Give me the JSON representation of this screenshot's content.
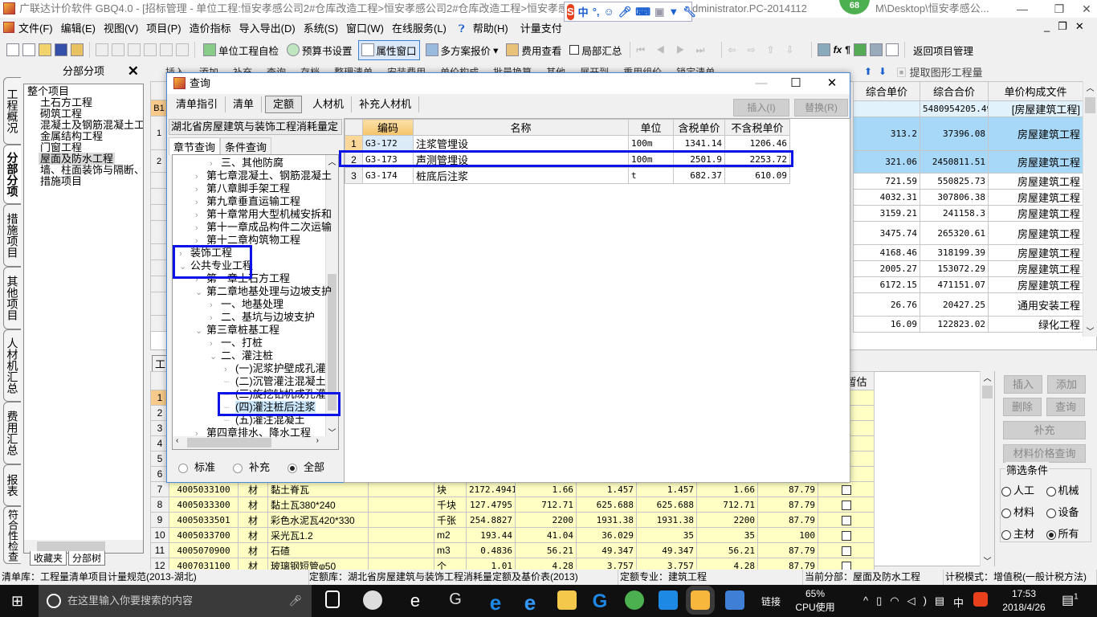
{
  "window": {
    "title": "广联达计价软件 GBQ4.0 - [招标管理 - 单位工程:恒安孝感公司2#仓库改造工程>恒安孝感公司2#仓库改造工程>恒安孝感公司2#",
    "title_tail": "dministrator.PC-2014112",
    "title_tail2": "M\\Desktop\\恒安孝感公...",
    "badge": "68",
    "ime": {
      "logo": "S",
      "mode": "中",
      "punct": "°,"
    }
  },
  "menu": [
    "文件(F)",
    "编辑(E)",
    "视图(V)",
    "项目(P)",
    "造价指标",
    "导入导出(D)",
    "系统(S)",
    "窗口(W)",
    "在线服务(L)",
    "帮助(H)",
    "计量支付"
  ],
  "toolbar": {
    "self_check": "单位工程自检",
    "budget_settings": "预算书设置",
    "property_window": "属性窗口",
    "multi_quote": "多方案报价",
    "fee_view": "费用查看",
    "partial_sum": "局部汇总",
    "return_project": "返回项目管理"
  },
  "toolbar2": {
    "items": [
      "插入",
      "添加",
      "补充",
      "查询",
      "存档",
      "整理清单",
      "安装费用",
      "单价构成",
      "批量换算",
      "其他",
      "展开到",
      "重用组价",
      "锁定清单"
    ],
    "extract": "提取图形工程量"
  },
  "vtabs": [
    "工程概况",
    "分部分项",
    "措施项目",
    "其他项目",
    "人材机汇总",
    "费用汇总",
    "报表",
    "符合性检查"
  ],
  "left_panel": {
    "title": "分部分项",
    "root": "整个项目",
    "items": [
      "土石方工程",
      "砌筑工程",
      "混凝土及钢筋混凝土工程",
      "金属结构工程",
      "门窗工程",
      "屋面及防水工程",
      "墙、柱面装饰与隔断、幕墙工程",
      "措施项目"
    ],
    "selected": "屋面及防水工程",
    "bottom_tabs": [
      "收藏夹",
      "分部树"
    ]
  },
  "main_grid": {
    "columns": [
      "综合单价",
      "综合合价",
      "单价构成文件"
    ],
    "row_headers": [
      "B1",
      "1",
      "2",
      "",
      "",
      "",
      "",
      "",
      "",
      "",
      "",
      ""
    ],
    "rows": [
      [
        "",
        "5480954205.49",
        "[房屋建筑工程]"
      ],
      [
        "313.2",
        "37396.08",
        "房屋建筑工程"
      ],
      [
        "321.06",
        "2450811.51",
        "房屋建筑工程"
      ],
      [
        "721.59",
        "550825.73",
        "房屋建筑工程"
      ],
      [
        "4032.31",
        "307806.38",
        "房屋建筑工程"
      ],
      [
        "3159.21",
        "241158.3",
        "房屋建筑工程"
      ],
      [
        "3475.74",
        "265320.61",
        "房屋建筑工程"
      ],
      [
        "4168.46",
        "318199.39",
        "房屋建筑工程"
      ],
      [
        "2005.27",
        "153072.29",
        "房屋建筑工程"
      ],
      [
        "6172.15",
        "471151.07",
        "房屋建筑工程"
      ],
      [
        "26.76",
        "20427.25",
        "通用安装工程"
      ],
      [
        "16.09",
        "122823.02",
        "绿化工程"
      ]
    ]
  },
  "bottom_grid": {
    "tab": "工",
    "last_column": "是否暂估",
    "rows": [
      [
        "1",
        "",
        "",
        "",
        "",
        "",
        "",
        "",
        "",
        "",
        "",
        "",
        false
      ],
      [
        "2",
        "",
        "",
        "",
        "",
        "",
        "",
        "",
        "",
        "",
        "",
        "",
        false
      ],
      [
        "3",
        "",
        "",
        "",
        "",
        "",
        "",
        "",
        "",
        "",
        "",
        "",
        false
      ],
      [
        "4",
        "",
        "",
        "",
        "",
        "",
        "",
        "",
        "",
        "",
        "",
        "",
        false
      ],
      [
        "5",
        "",
        "",
        "",
        "",
        "",
        "",
        "",
        "",
        "",
        "",
        "",
        false
      ],
      [
        "6",
        "",
        "",
        "",
        "",
        "",
        "",
        "",
        "",
        "",
        "",
        "",
        false
      ],
      [
        "7",
        "4005033100",
        "材",
        "黏土脊瓦",
        "",
        "块",
        "2172.4941",
        "1.66",
        "1.457",
        "1.457",
        "1.66",
        "87.79",
        true
      ],
      [
        "8",
        "4005033300",
        "材",
        "黏土瓦380*240",
        "",
        "千块",
        "127.4795",
        "712.71",
        "625.688",
        "625.688",
        "712.71",
        "87.79",
        true
      ],
      [
        "9",
        "4005033501",
        "材",
        "彩色水泥瓦420*330",
        "",
        "千张",
        "254.8827",
        "2200",
        "1931.38",
        "1931.38",
        "2200",
        "87.79",
        true
      ],
      [
        "10",
        "4005033700",
        "材",
        "采光瓦1.2",
        "",
        "m2",
        "193.44",
        "41.04",
        "36.029",
        "35",
        "35",
        "100",
        true
      ],
      [
        "11",
        "4005070900",
        "材",
        "石碴",
        "",
        "m3",
        "0.4836",
        "56.21",
        "49.347",
        "49.347",
        "56.21",
        "87.79",
        true
      ],
      [
        "12",
        "4007031100",
        "材",
        "玻璃钢短管φ50",
        "",
        "个",
        "1.01",
        "4.28",
        "3.757",
        "3.757",
        "4.28",
        "87.79",
        true
      ]
    ]
  },
  "right_panel": {
    "buttons": {
      "insert": "插入",
      "add": "添加",
      "delete": "删除",
      "query": "查询",
      "supplement": "补充",
      "material_price": "材料价格查询"
    },
    "filter": {
      "legend": "筛选条件",
      "options": [
        "人工",
        "机械",
        "材料",
        "设备",
        "主材",
        "所有"
      ],
      "selected": "所有"
    }
  },
  "dialog": {
    "title": "查询",
    "tabs": [
      "清单指引",
      "清单",
      "定额",
      "人材机",
      "补充人材机"
    ],
    "active_tab": "定额",
    "combo": "湖北省房屋建筑与装饰工程消耗量定",
    "subtabs": [
      "章节查询",
      "条件查询"
    ],
    "insert_btn": "插入(I)",
    "replace_btn": "替换(R)",
    "tree": [
      {
        "label": "三、其他防腐",
        "level": 2,
        "state": "collapsed"
      },
      {
        "label": "第七章混凝土、钢筋混凝土",
        "level": 1,
        "state": "collapsed"
      },
      {
        "label": "第八章脚手架工程",
        "level": 1,
        "state": "collapsed"
      },
      {
        "label": "第九章垂直运输工程",
        "level": 1,
        "state": "collapsed"
      },
      {
        "label": "第十章常用大型机械安拆和",
        "level": 1,
        "state": "collapsed"
      },
      {
        "label": "第十一章成品构件二次运输",
        "level": 1,
        "state": "collapsed"
      },
      {
        "label": "第十二章构筑物工程",
        "level": 1,
        "state": "collapsed"
      },
      {
        "label": "装饰工程",
        "level": 0,
        "state": "collapsed"
      },
      {
        "label": "公共专业工程",
        "level": 0,
        "state": "expanded"
      },
      {
        "label": "第一章土石方工程",
        "level": 1,
        "state": "collapsed"
      },
      {
        "label": "第二章地基处理与边坡支护",
        "level": 1,
        "state": "expanded"
      },
      {
        "label": "一、地基处理",
        "level": 2,
        "state": "collapsed"
      },
      {
        "label": "二、基坑与边坡支护",
        "level": 2,
        "state": "collapsed"
      },
      {
        "label": "第三章桩基工程",
        "level": 1,
        "state": "expanded"
      },
      {
        "label": "一、打桩",
        "level": 2,
        "state": "collapsed"
      },
      {
        "label": "二、灌注桩",
        "level": 2,
        "state": "expanded"
      },
      {
        "label": "(一)泥浆护壁成孔灌",
        "level": 3,
        "state": "collapsed"
      },
      {
        "label": "(二)沉管灌注混凝土",
        "level": 3,
        "state": "leaf"
      },
      {
        "label": "(三)旋挖钻机成孔灌",
        "level": 3,
        "state": "leaf"
      },
      {
        "label": "(四)灌注桩后注浆",
        "level": 3,
        "state": "leaf",
        "selected": true
      },
      {
        "label": "(五)灌注混凝土",
        "level": 3,
        "state": "leaf"
      },
      {
        "label": "第四章排水、降水工程",
        "level": 1,
        "state": "collapsed"
      }
    ],
    "radios": [
      "标准",
      "补充",
      "全部"
    ],
    "radio_selected": "全部",
    "grid": {
      "columns": [
        "",
        "编码",
        "名称",
        "单位",
        "含税单价",
        "不含税单价"
      ],
      "rows": [
        [
          "1",
          "G3-172",
          "注浆管埋设",
          "100m",
          "1341.14",
          "1206.46"
        ],
        [
          "2",
          "G3-173",
          "声测管埋设",
          "100m",
          "2501.9",
          "2253.72"
        ],
        [
          "3",
          "G3-174",
          "桩底后注浆",
          "t",
          "682.37",
          "610.09"
        ]
      ]
    }
  },
  "statusbar": [
    "清单库：工程量清单项目计量规范(2013-湖北)",
    "定额库：湖北省房屋建筑与装饰工程消耗量定额及基价表(2013)",
    "定额专业：建筑工程",
    "当前分部：屋面及防水工程",
    "计税模式：增值税(一般计税方法)"
  ],
  "taskbar": {
    "search_placeholder": "在这里输入你要搜索的内容",
    "link": "链接",
    "cpu_value": "65%",
    "cpu_label": "CPU使用",
    "ime": "中",
    "time": "17:53",
    "date": "2018/4/26",
    "notifications": "1"
  },
  "colors": {
    "highlight_box": "#0a14e6",
    "selected_row": "#a8d8f7",
    "material_row": "#ffffc4",
    "header_orange": "#f5c46b"
  }
}
